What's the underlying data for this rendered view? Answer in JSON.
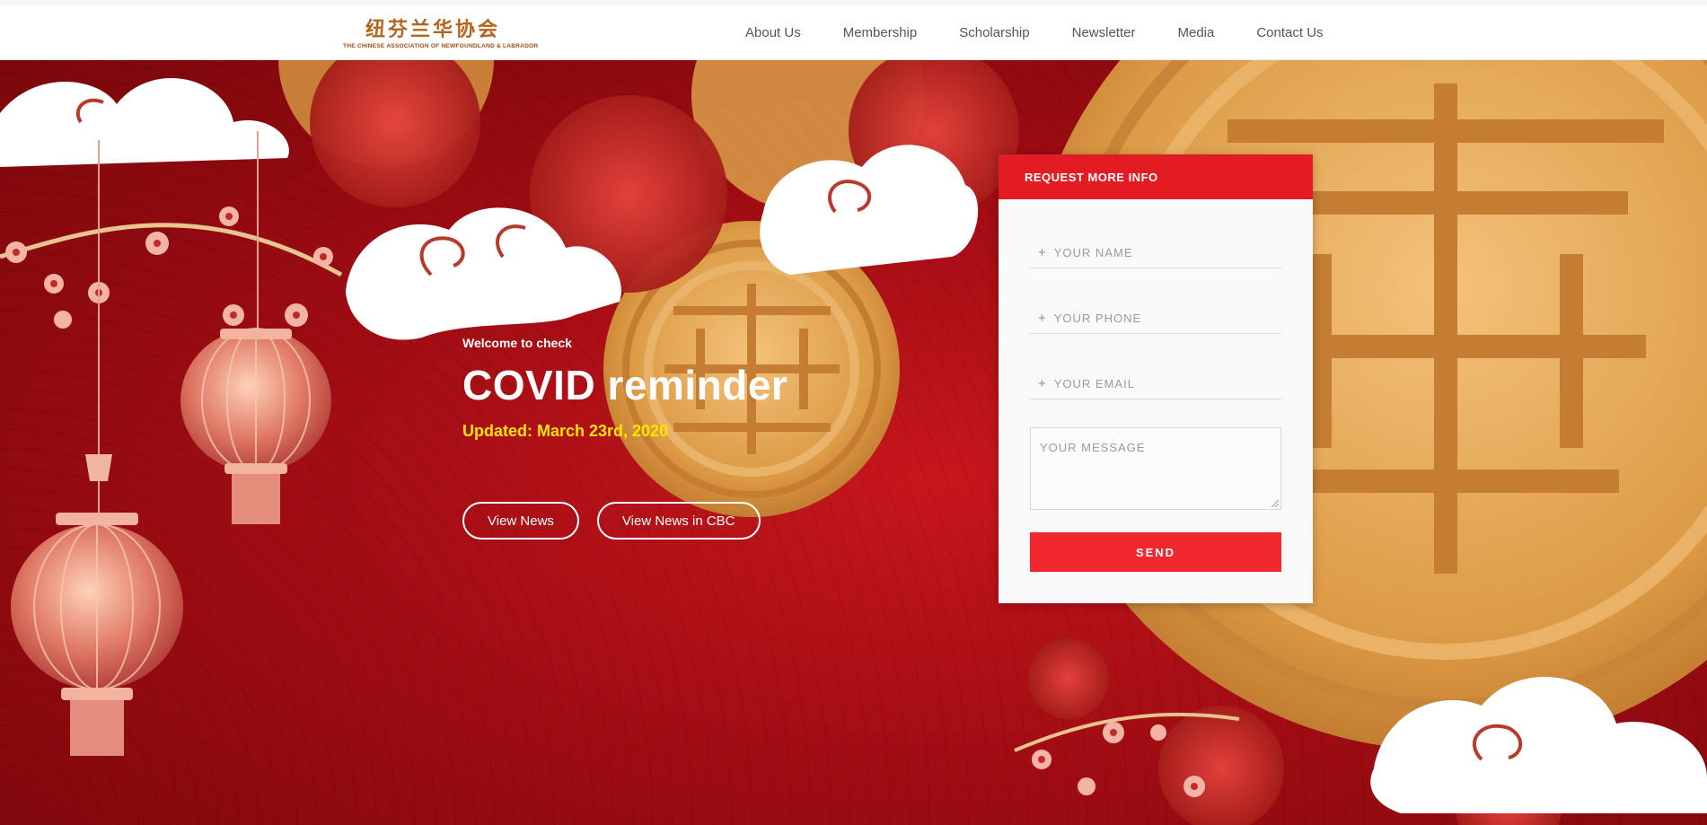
{
  "header": {
    "logo_cn": "纽芬兰华协会",
    "logo_en": "THE CHINESE ASSOCIATION OF NEWFOUNDLAND & LABRADOR",
    "nav": [
      "About Us",
      "Membership",
      "Scholarship",
      "Newsletter",
      "Media",
      "Contact Us"
    ]
  },
  "hero": {
    "welcome": "Welcome to check",
    "headline": "COVID reminder",
    "updated": "Updated: March 23rd, 2020",
    "buttons": [
      "View News",
      "View News in CBC"
    ]
  },
  "form": {
    "title": "REQUEST MORE INFO",
    "name_placeholder": "YOUR NAME",
    "phone_placeholder": "YOUR PHONE",
    "email_placeholder": "YOUR EMAIL",
    "message_placeholder": "YOUR MESSAGE",
    "send_label": "SEND"
  },
  "colors": {
    "brand_red": "#e31b23",
    "send_red": "#f0282e",
    "updated_yellow": "#ffe500",
    "logo_brown": "#b5651d"
  }
}
